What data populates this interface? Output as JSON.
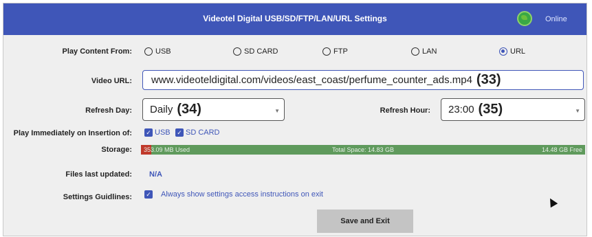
{
  "header": {
    "title": "Videotel Digital USB/SD/FTP/LAN/URL Settings",
    "status": "Online",
    "status_icon": "globe-icon"
  },
  "play_content": {
    "label": "Play Content From:",
    "options": [
      {
        "label": "USB",
        "selected": false
      },
      {
        "label": "SD CARD",
        "selected": false
      },
      {
        "label": "FTP",
        "selected": false
      },
      {
        "label": "LAN",
        "selected": false
      },
      {
        "label": "URL",
        "selected": true
      }
    ]
  },
  "video_url": {
    "label": "Video URL:",
    "value": "www.videoteldigital.com/videos/east_coast/perfume_counter_ads.mp4",
    "annotation": "(33)"
  },
  "refresh_day": {
    "label": "Refresh Day:",
    "value": "Daily",
    "annotation": "(34)"
  },
  "refresh_hour": {
    "label": "Refresh Hour:",
    "value": "23:00",
    "annotation": "(35)"
  },
  "play_immediately": {
    "label": "Play Immediately on Insertion of:",
    "options": [
      {
        "label": "USB",
        "checked": true
      },
      {
        "label": "SD CARD",
        "checked": true
      }
    ]
  },
  "storage": {
    "label": "Storage:",
    "used_text": "353.09 MB Used",
    "total_text": "Total Space: 14.83 GB",
    "free_text": "14.48 GB Free",
    "used_fraction": 0.0238
  },
  "files_updated": {
    "label": "Files last updated:",
    "value": "N/A"
  },
  "guidelines": {
    "label": "Settings Guidlines:",
    "checked": true,
    "text": "Always show settings access instructions on exit"
  },
  "save_button": "Save and Exit",
  "colors": {
    "accent": "#3f56b8",
    "storage_used": "#c0392b",
    "storage_free": "#5f9a5c"
  }
}
